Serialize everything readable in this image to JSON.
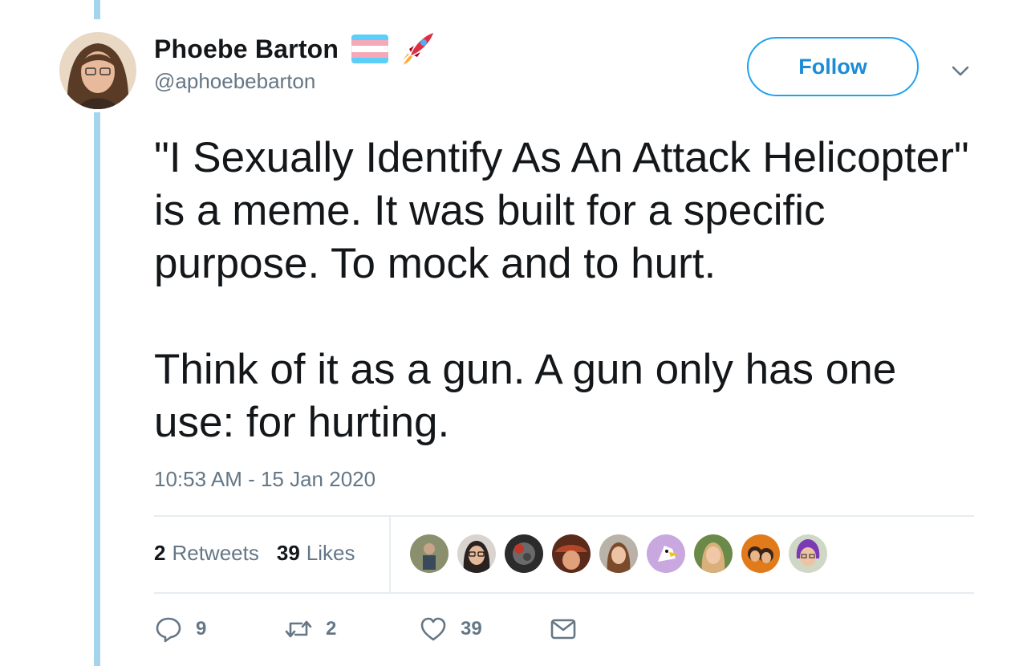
{
  "author": {
    "name": "Phoebe Barton",
    "handle": "@aphoebebarton",
    "name_emojis": [
      "transgender-flag-icon",
      "rocket-icon"
    ]
  },
  "follow_button": {
    "label": "Follow"
  },
  "tweet": {
    "text": "\"I Sexually Identify As An Attack Helicopter\" is a meme. It was built for a specific purpose. To mock and to hurt.\n\nThink of it as a gun. A gun only has one use: for hurting.",
    "timestamp": "10:53 AM - 15 Jan 2020"
  },
  "stats": {
    "retweets_count": "2",
    "retweets_label": "Retweets",
    "likes_count": "39",
    "likes_label": "Likes"
  },
  "liked_by_avatars_count": 9,
  "actions": {
    "reply_count": "9",
    "retweet_count": "2",
    "like_count": "39"
  },
  "colors": {
    "accent": "#1da1f2",
    "thread_line": "#a4d5ec",
    "muted_text": "#657786",
    "divider": "#e6ecf0"
  }
}
